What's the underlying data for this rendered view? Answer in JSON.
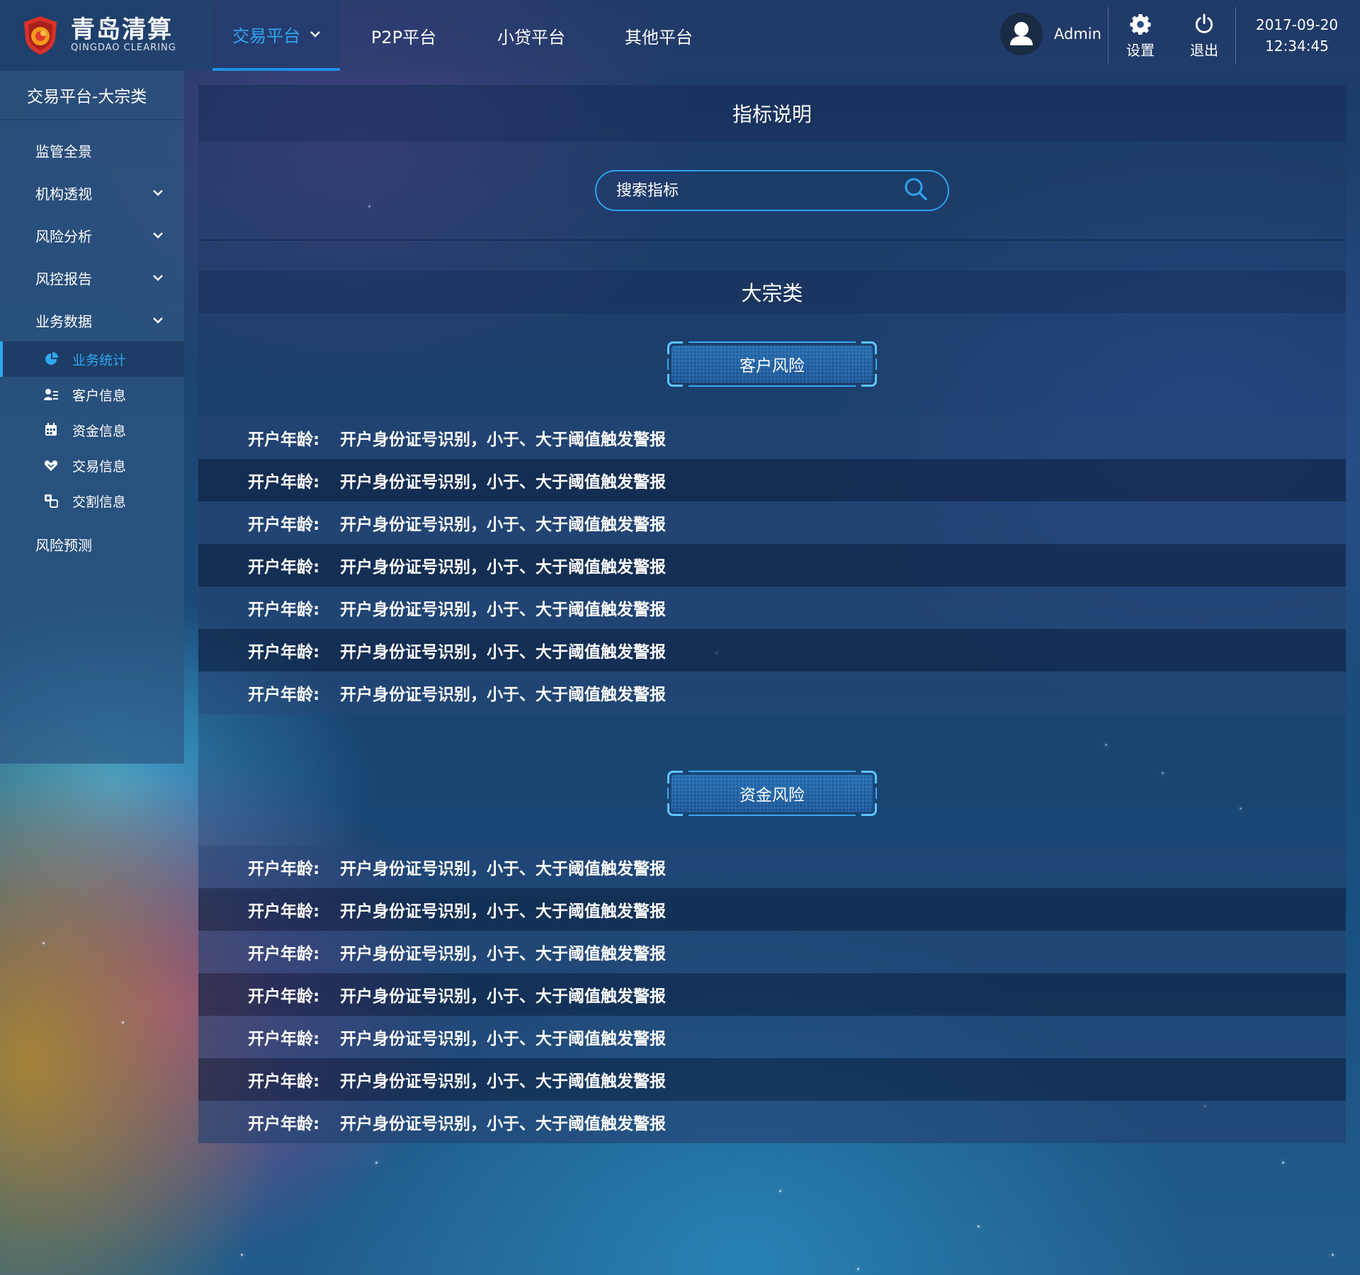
{
  "brand": {
    "name_cn": "青岛清算",
    "name_en": "QINGDAO CLEARING"
  },
  "nav": {
    "items": [
      {
        "label": "交易平台",
        "active": true
      },
      {
        "label": "P2P平台"
      },
      {
        "label": "小贷平台"
      },
      {
        "label": "其他平台"
      }
    ]
  },
  "user": {
    "name": "Admin",
    "settings_label": "设置",
    "logout_label": "退出",
    "date": "2017-09-20",
    "time": "12:34:45"
  },
  "sidebar": {
    "title": "交易平台-大宗类",
    "items": [
      {
        "label": "监管全景"
      },
      {
        "label": "机构透视",
        "icon": "chevron-down-icon"
      },
      {
        "label": "风险分析",
        "icon": "chevron-down-icon"
      },
      {
        "label": "风控报告",
        "icon": "chevron-down-icon"
      },
      {
        "label": "业务数据",
        "icon": "chevron-down-icon"
      }
    ],
    "subitems": [
      {
        "label": "业务统计",
        "icon": "pie-chart-icon",
        "active": true
      },
      {
        "label": "客户信息",
        "icon": "user-list-icon"
      },
      {
        "label": "资金信息",
        "icon": "calendar-icon"
      },
      {
        "label": "交易信息",
        "icon": "handshake-icon"
      },
      {
        "label": "交割信息",
        "icon": "exchange-icon"
      }
    ],
    "last_item": {
      "label": "风险预测"
    }
  },
  "main": {
    "title": "指标说明",
    "search_placeholder": "搜索指标",
    "category": "大宗类",
    "sections": [
      {
        "title": "客户风险",
        "rows": [
          {
            "label": "开户年龄:",
            "desc": "开户身份证号识别，小于、大于阈值触发警报"
          },
          {
            "label": "开户年龄:",
            "desc": "开户身份证号识别，小于、大于阈值触发警报"
          },
          {
            "label": "开户年龄:",
            "desc": "开户身份证号识别，小于、大于阈值触发警报"
          },
          {
            "label": "开户年龄:",
            "desc": "开户身份证号识别，小于、大于阈值触发警报"
          },
          {
            "label": "开户年龄:",
            "desc": "开户身份证号识别，小于、大于阈值触发警报"
          },
          {
            "label": "开户年龄:",
            "desc": "开户身份证号识别，小于、大于阈值触发警报"
          },
          {
            "label": "开户年龄:",
            "desc": "开户身份证号识别，小于、大于阈值触发警报"
          }
        ]
      },
      {
        "title": "资金风险",
        "rows": [
          {
            "label": "开户年龄:",
            "desc": "开户身份证号识别，小于、大于阈值触发警报"
          },
          {
            "label": "开户年龄:",
            "desc": "开户身份证号识别，小于、大于阈值触发警报"
          },
          {
            "label": "开户年龄:",
            "desc": "开户身份证号识别，小于、大于阈值触发警报"
          },
          {
            "label": "开户年龄:",
            "desc": "开户身份证号识别，小于、大于阈值触发警报"
          },
          {
            "label": "开户年龄:",
            "desc": "开户身份证号识别，小于、大于阈值触发警报"
          },
          {
            "label": "开户年龄:",
            "desc": "开户身份证号识别，小于、大于阈值触发警报"
          },
          {
            "label": "开户年龄:",
            "desc": "开户身份证号识别，小于、大于阈值触发警报"
          }
        ]
      }
    ]
  },
  "colors": {
    "accent": "#2fa7f0",
    "section_border": "#5ec4ff",
    "logo_red": "#d8322a",
    "logo_orange": "#f39a1e"
  }
}
